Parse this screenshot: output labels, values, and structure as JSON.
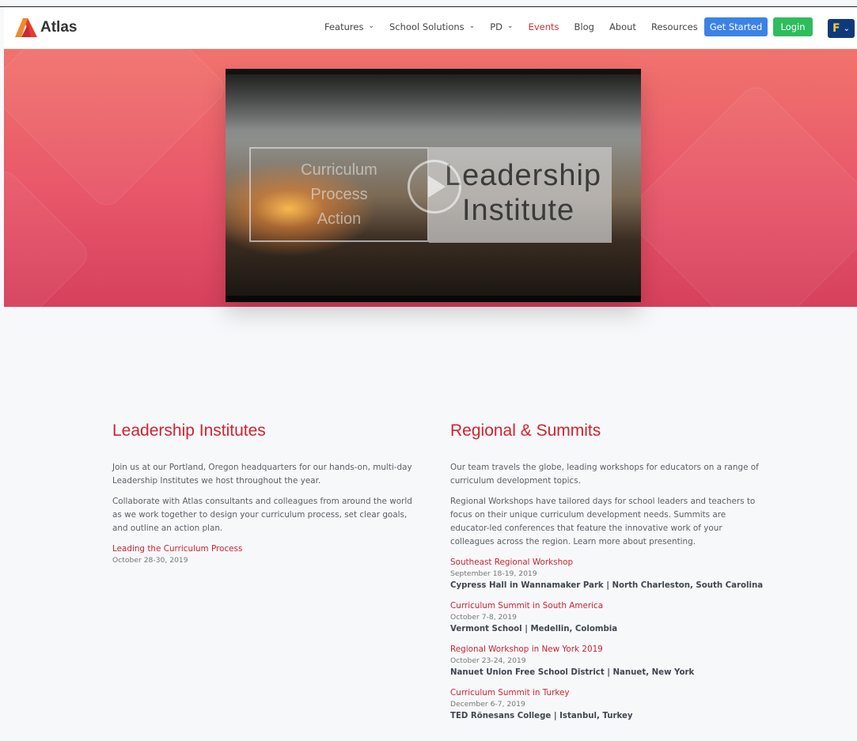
{
  "brand": {
    "name": "Atlas"
  },
  "nav": {
    "items": [
      {
        "label": "Features",
        "dropdown": true
      },
      {
        "label": "School Solutions",
        "dropdown": true
      },
      {
        "label": "PD",
        "dropdown": true
      },
      {
        "label": "Events",
        "dropdown": false,
        "active": true
      },
      {
        "label": "Blog",
        "dropdown": false
      },
      {
        "label": "About",
        "dropdown": false
      },
      {
        "label": "Resources",
        "dropdown": true
      }
    ],
    "get_started": "Get Started",
    "login": "Login",
    "user_initial": "F"
  },
  "video": {
    "left_words": [
      "Curriculum",
      "Process",
      "Action"
    ],
    "right_words": [
      "Leadership",
      "Institute"
    ]
  },
  "leadership": {
    "heading": "Leadership Institutes",
    "paragraphs": [
      "Join us at our Portland, Oregon headquarters for our hands-on, multi-day Leadership Institutes we host throughout the year.",
      "Collaborate with Atlas consultants and colleagues from around the world as we work together to design your curriculum process, set clear goals, and outline an action plan."
    ],
    "events": [
      {
        "title": "Leading the Curriculum Process",
        "date": "October 28-30, 2019"
      }
    ]
  },
  "regional": {
    "heading": "Regional & Summits",
    "paragraphs": [
      "Our team travels the globe, leading workshops for educators on a range of curriculum development topics.",
      "Regional Workshops have tailored days for school leaders and teachers to focus on their unique curriculum development needs. Summits are educator-led conferences that feature the innovative work of your colleagues across the region. Learn more about presenting."
    ],
    "events": [
      {
        "title": "Southeast Regional Workshop",
        "date": "September 18-19, 2019",
        "venue": "Cypress Hall in Wannamaker Park | North Charleston, South Carolina"
      },
      {
        "title": "Curriculum Summit in South America",
        "date": "October 7-8, 2019",
        "venue": "Vermont School | Medellin, Colombia"
      },
      {
        "title": "Regional Workshop in New York 2019",
        "date": "October 23-24, 2019",
        "venue": "Nanuet Union Free School District | Nanuet, New York"
      },
      {
        "title": "Curriculum Summit in Turkey",
        "date": "December 6-7, 2019",
        "venue": "TED Rönesans College | Istanbul, Turkey"
      }
    ]
  },
  "colors": {
    "accent": "#d0232f",
    "primary_button": "#3b82e6",
    "login_button": "#2ebd5c",
    "user_menu": "#0e3a7c"
  },
  "icons": {
    "logo": "atlas-logo-icon",
    "chevron": "chevron-down-icon",
    "play": "play-icon"
  }
}
